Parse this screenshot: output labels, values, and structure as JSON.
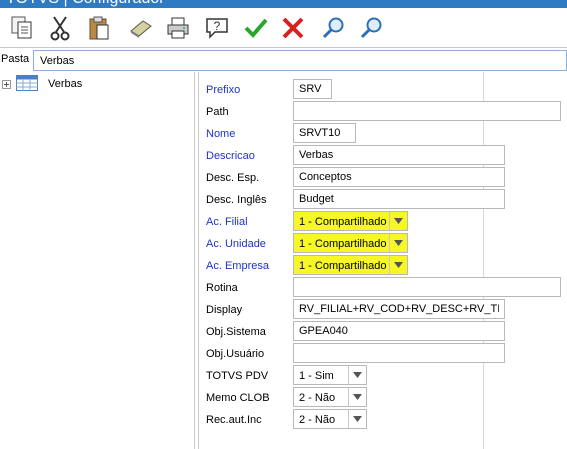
{
  "window": {
    "title": "TOTVS | Configurador"
  },
  "toolbar": {
    "icons": [
      "copy-icon",
      "cut-icon",
      "paste-icon",
      "eraser-icon",
      "print-icon",
      "help-icon",
      "confirm-icon",
      "cancel-icon",
      "search-icon",
      "search-next-icon"
    ]
  },
  "pasta": {
    "label": "Pasta",
    "value": "Verbas"
  },
  "tree": {
    "item_label": "Verbas"
  },
  "form": {
    "prefixo": {
      "label": "Prefixo",
      "value": "SRV"
    },
    "path": {
      "label": "Path",
      "value": ""
    },
    "nome": {
      "label": "Nome",
      "value": "SRVT10"
    },
    "descricao": {
      "label": "Descricao",
      "value": "Verbas"
    },
    "desc_esp": {
      "label": "Desc. Esp.",
      "value": "Conceptos"
    },
    "desc_ingles": {
      "label": "Desc. Inglês",
      "value": "Budget"
    },
    "ac_filial": {
      "label": "Ac. Filial",
      "value": "1 - Compartilhado"
    },
    "ac_unidade": {
      "label": "Ac. Unidade",
      "value": "1 - Compartilhado"
    },
    "ac_empresa": {
      "label": "Ac. Empresa",
      "value": "1 - Compartilhado"
    },
    "rotina": {
      "label": "Rotina",
      "value": ""
    },
    "display": {
      "label": "Display",
      "value": "RV_FILIAL+RV_COD+RV_DESC+RV_TIPOCOD"
    },
    "obj_sistema": {
      "label": "Obj.Sistema",
      "value": "GPEA040"
    },
    "obj_usuario": {
      "label": "Obj.Usuário",
      "value": ""
    },
    "totvs_pdv": {
      "label": "TOTVS PDV",
      "value": "1 - Sim"
    },
    "memo_clob": {
      "label": "Memo CLOB",
      "value": "2 - Não"
    },
    "rec_aut_inc": {
      "label": "Rec.aut.Inc",
      "value": "2 - Não"
    }
  },
  "colors": {
    "label_blue": "#1f33c8",
    "highlight": "#f7f727",
    "title_bar": "#2e7bc4"
  }
}
